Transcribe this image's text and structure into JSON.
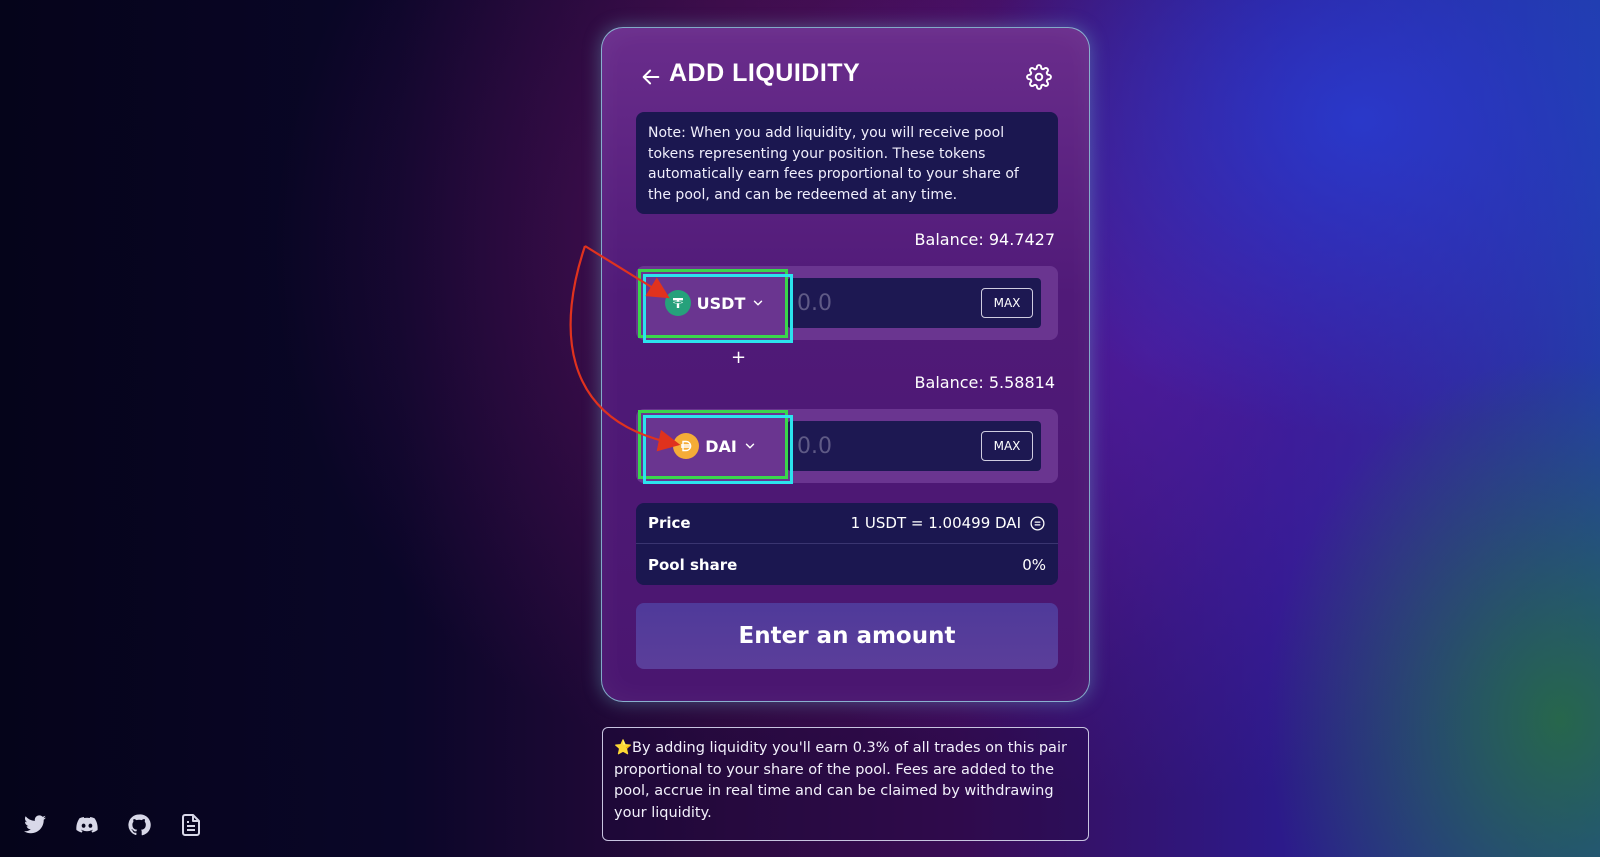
{
  "header": {
    "title": "ADD LIQUIDITY",
    "back_icon": "arrow-left-icon",
    "settings_icon": "gear-icon"
  },
  "note": {
    "text": "Note: When you add liquidity, you will receive pool tokens representing your position. These tokens automatically earn fees proportional to your share of the pool, and can be redeemed at any time."
  },
  "token_a": {
    "balance": "Balance: 94.7427",
    "symbol": "USDT",
    "icon": "tether-icon",
    "amount_placeholder": "0.0",
    "max_label": "MAX"
  },
  "plus": "+",
  "token_b": {
    "balance": "Balance: 5.58814",
    "symbol": "DAI",
    "icon": "dai-icon",
    "amount_placeholder": "0.0",
    "max_label": "MAX"
  },
  "info": {
    "price_label": "Price",
    "price_value": "1 USDT = 1.00499 DAI",
    "pool_share_label": "Pool share",
    "pool_share_value": "0%"
  },
  "submit_label": "Enter an amount",
  "footer_note": "⭐By adding liquidity you'll earn 0.3% of all trades on this pair proportional to your share of the pool. Fees are added to the pool, accrue in real time and can be claimed by withdrawing your liquidity.",
  "social_links": [
    "twitter-icon",
    "discord-icon",
    "github-icon",
    "docs-icon"
  ],
  "colors": {
    "annotation_green": "#3ad64b",
    "annotation_cyan": "#2ce3ee",
    "annotation_arrow": "#e0321e",
    "tether": "#26a17b",
    "dai": "#f5ac37"
  }
}
